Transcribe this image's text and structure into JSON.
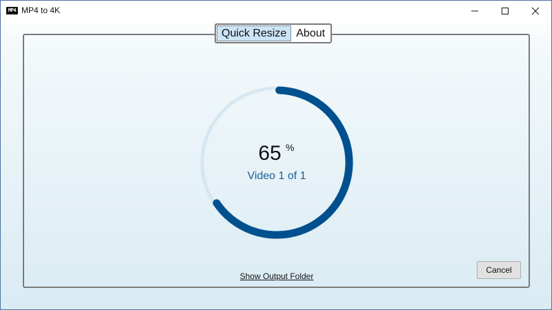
{
  "window": {
    "title": "MP4 to 4K",
    "icon_label": "MP4",
    "icons": {
      "app": "mp4-file-icon",
      "minimize": "minimize-icon",
      "maximize": "maximize-icon",
      "close": "close-icon"
    }
  },
  "tabs": [
    {
      "label": "Quick Resize",
      "active": true
    },
    {
      "label": "About",
      "active": false
    }
  ],
  "progress": {
    "percent": 0.65,
    "value_text": "65",
    "unit": "%",
    "status": "Video 1 of 1"
  },
  "actions": {
    "show_output_label": "Show Output Folder",
    "cancel_label": "Cancel"
  },
  "colors": {
    "progress_fill": "#00508f",
    "progress_track": "#cfe3ef",
    "status_text": "#1d5c96",
    "active_tab": "#cce4f7"
  }
}
